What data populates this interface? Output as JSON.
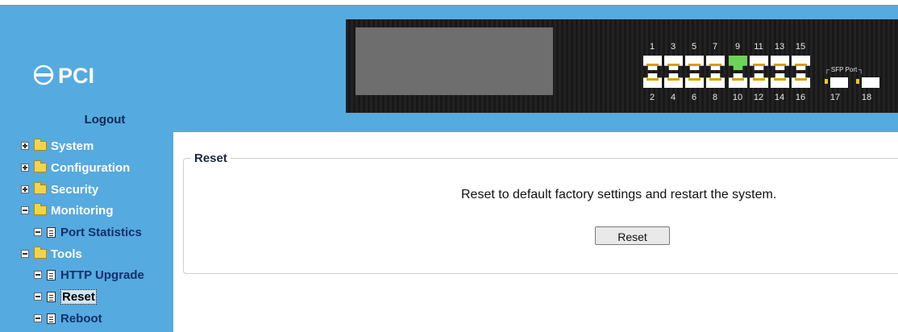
{
  "brand": {
    "logo_text": "PCI"
  },
  "header": {
    "logout_label": "Logout"
  },
  "panel": {
    "top_port_numbers": [
      "1",
      "3",
      "5",
      "7",
      "9",
      "11",
      "13",
      "15"
    ],
    "bottom_port_numbers": [
      "2",
      "4",
      "6",
      "8",
      "10",
      "12",
      "14",
      "16"
    ],
    "sfp_label": "SFP Port",
    "sfp_numbers": [
      "17",
      "18"
    ],
    "active_port": "9"
  },
  "menu": {
    "items": [
      {
        "label": "System",
        "type": "folder",
        "state": "collapsed"
      },
      {
        "label": "Configuration",
        "type": "folder",
        "state": "collapsed"
      },
      {
        "label": "Security",
        "type": "folder",
        "state": "collapsed"
      },
      {
        "label": "Monitoring",
        "type": "folder",
        "state": "expanded"
      },
      {
        "label": "Port Statistics",
        "type": "page"
      },
      {
        "label": "Tools",
        "type": "folder",
        "state": "expanded"
      },
      {
        "label": "HTTP Upgrade",
        "type": "page"
      },
      {
        "label": "Reset",
        "type": "page",
        "selected": true
      },
      {
        "label": "Reboot",
        "type": "page"
      }
    ]
  },
  "main": {
    "section_title": "Reset",
    "description": "Reset to default factory settings and restart the system.",
    "reset_button": "Reset"
  },
  "colors": {
    "sidebar_bg": "#55aae0",
    "menu_text_light": "#ffffff",
    "menu_text_dark": "#12306a"
  }
}
